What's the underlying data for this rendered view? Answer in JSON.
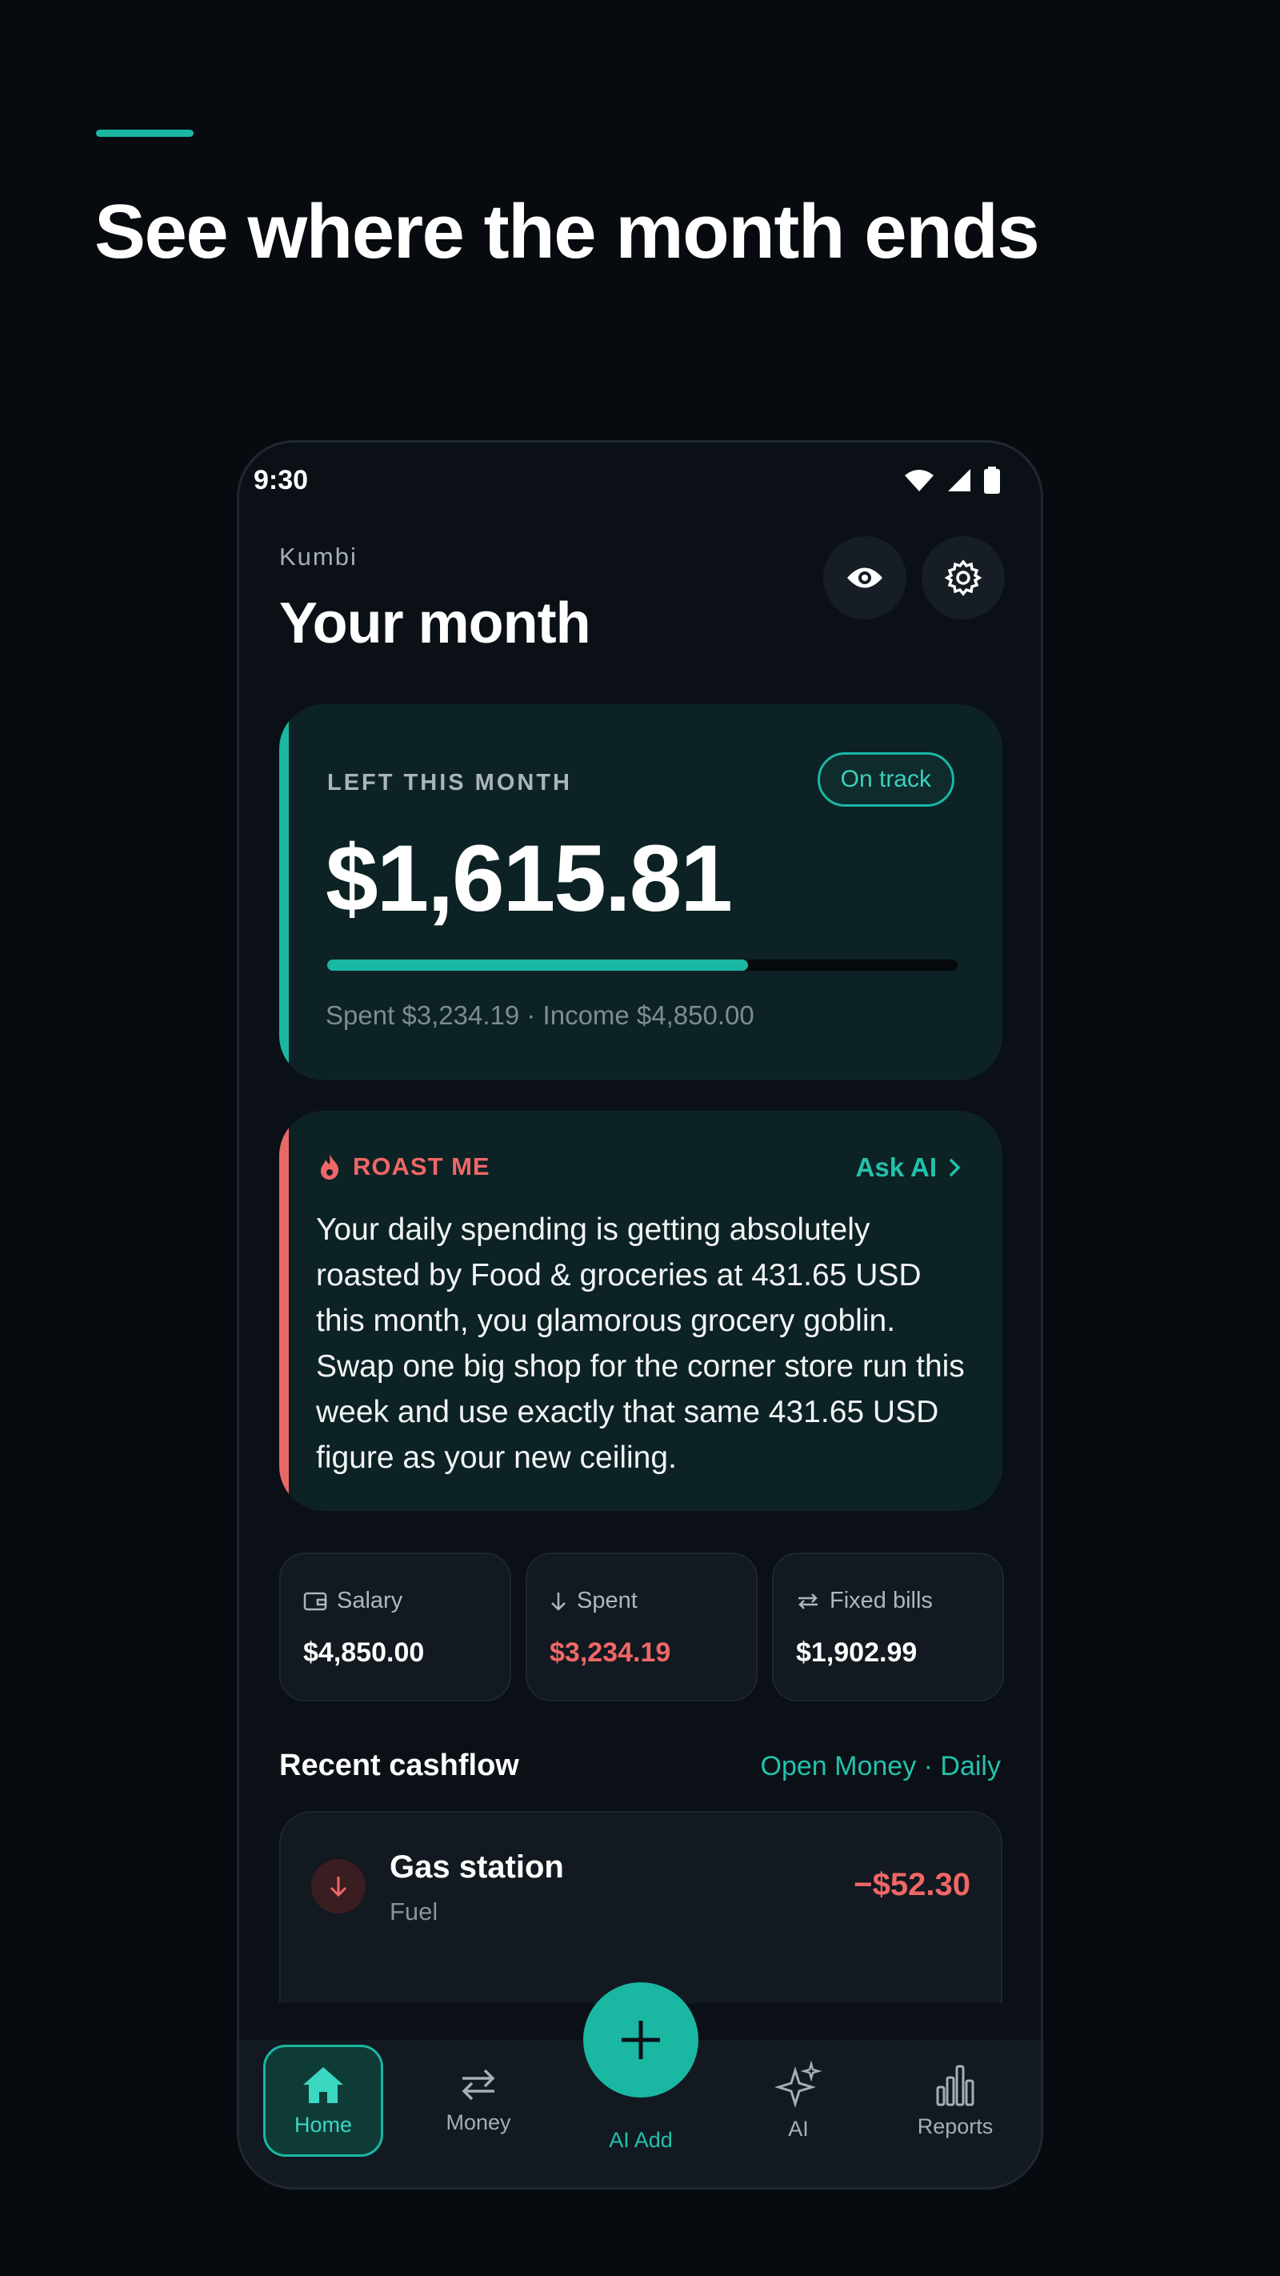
{
  "headline": "See where the month ends",
  "status_bar": {
    "time": "9:30"
  },
  "header": {
    "subtitle": "Kumbi",
    "title": "Your month"
  },
  "left_card": {
    "label": "LEFT THIS MONTH",
    "badge": "On track",
    "amount": "$1,615.81",
    "progress_fraction": 0.667,
    "footer": "Spent $3,234.19 · Income $4,850.00"
  },
  "roast_card": {
    "label": "ROAST ME",
    "action": "Ask AI",
    "text": "Your daily spending is getting absolutely roasted by Food & groceries at 431.65 USD this month, you glamorous grocery goblin. Swap one big shop for the corner store run this week and use exactly that same 431.65 USD figure as your new ceiling."
  },
  "stats": [
    {
      "label": "Salary",
      "value": "$4,850.00",
      "icon": "wallet-icon"
    },
    {
      "label": "Spent",
      "value": "$3,234.19",
      "icon": "arrow-down-icon"
    },
    {
      "label": "Fixed bills",
      "value": "$1,902.99",
      "icon": "repeat-icon"
    }
  ],
  "recent": {
    "title": "Recent cashflow",
    "link": "Open Money · Daily",
    "transactions": [
      {
        "name": "Gas station",
        "category": "Fuel",
        "amount": "−$52.30"
      }
    ]
  },
  "nav": {
    "home": "Home",
    "money": "Money",
    "add": "AI Add",
    "ai": "AI",
    "reports": "Reports"
  },
  "colors": {
    "accent": "#1ab7a3",
    "negative": "#f16767",
    "background": "#070b10",
    "card": "#0d2224"
  }
}
